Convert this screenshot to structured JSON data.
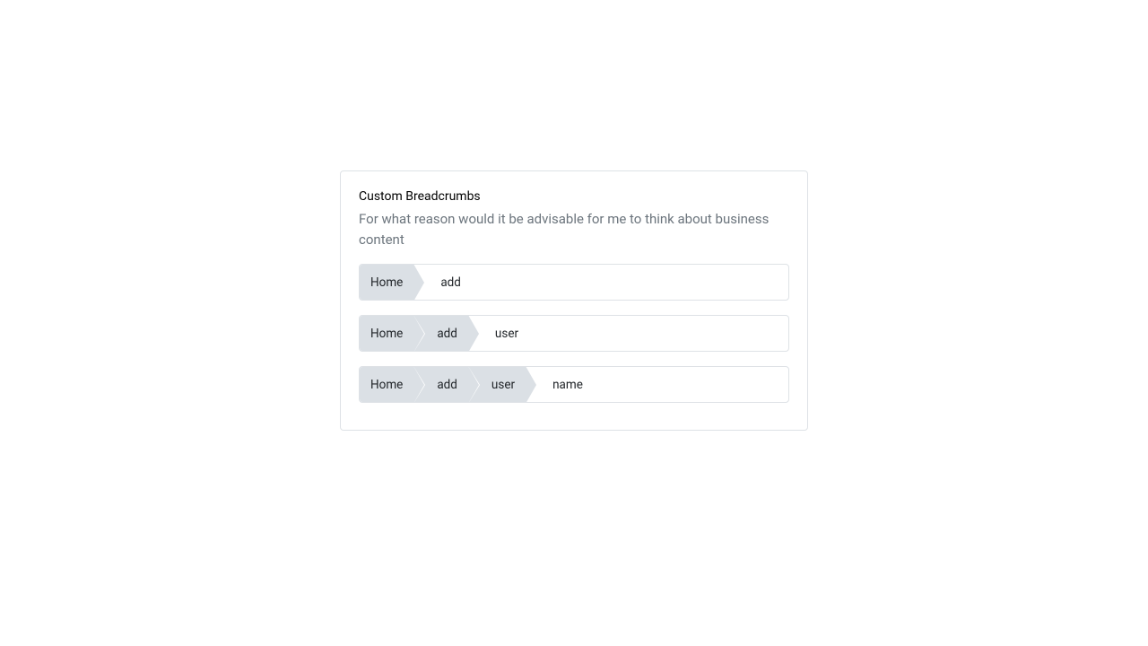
{
  "card": {
    "title": "Custom Breadcrumbs",
    "description": "For what reason would it be advisable for me to think about business content"
  },
  "breadcrumbs": [
    {
      "items": [
        "Home",
        "add"
      ]
    },
    {
      "items": [
        "Home",
        "add",
        "user"
      ]
    },
    {
      "items": [
        "Home",
        "add",
        "user",
        "name"
      ]
    }
  ]
}
